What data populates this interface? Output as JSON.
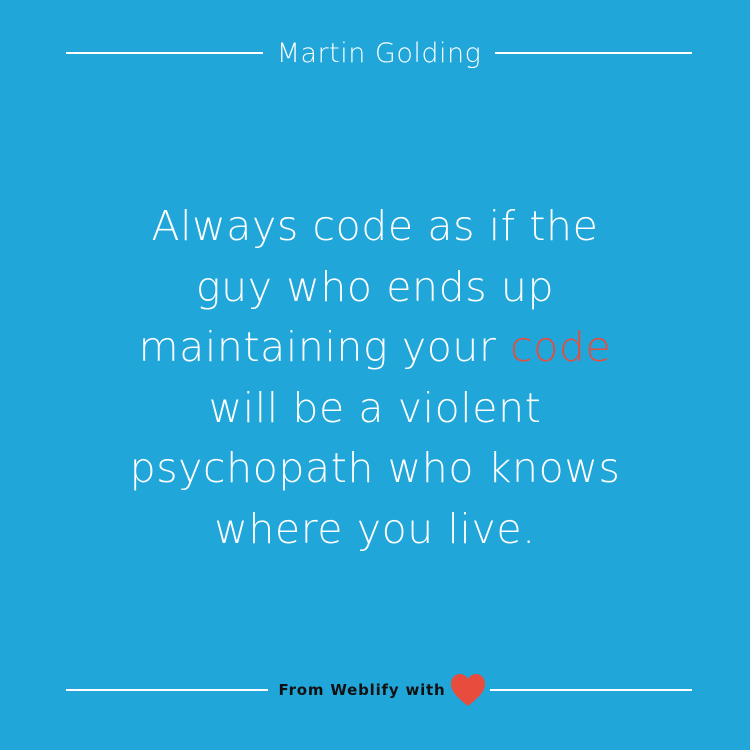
{
  "author": "Martin Golding",
  "quote": {
    "lines": [
      {
        "text": "Always code as if the"
      },
      {
        "text": "guy who ends up"
      },
      {
        "before": "maintaining your ",
        "highlight": "code"
      },
      {
        "text": "will be a violent"
      },
      {
        "text": "psychopath who knows"
      },
      {
        "text": "where you live."
      }
    ]
  },
  "footer": {
    "text": "From Weblify with"
  },
  "icons": {
    "heart": "heart-icon"
  },
  "colors": {
    "background": "#21a6da",
    "text": "#ffffff",
    "highlight": "#e74c3c",
    "footer_text": "#111111",
    "heart": "#e74c3c"
  }
}
